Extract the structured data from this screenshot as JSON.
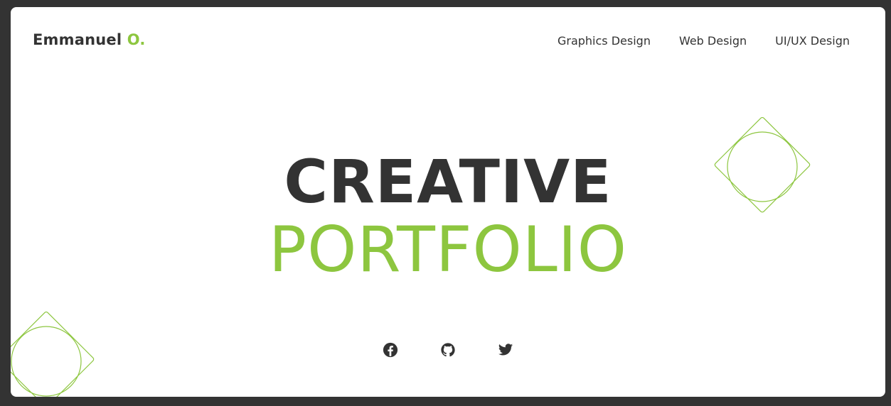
{
  "header": {
    "brand_name": "Emmanuel",
    "brand_initial": "O."
  },
  "nav": {
    "items": [
      {
        "label": "Graphics Design"
      },
      {
        "label": "Web Design"
      },
      {
        "label": "UI/UX Design"
      }
    ]
  },
  "hero": {
    "line1": "CREATIVE",
    "line2": "PORTFOLIO"
  },
  "social": {
    "icons": [
      "facebook-icon",
      "github-icon",
      "twitter-icon"
    ]
  },
  "colors": {
    "accent": "#8dc63f",
    "text": "#333333",
    "background": "#333333",
    "card": "#ffffff"
  }
}
